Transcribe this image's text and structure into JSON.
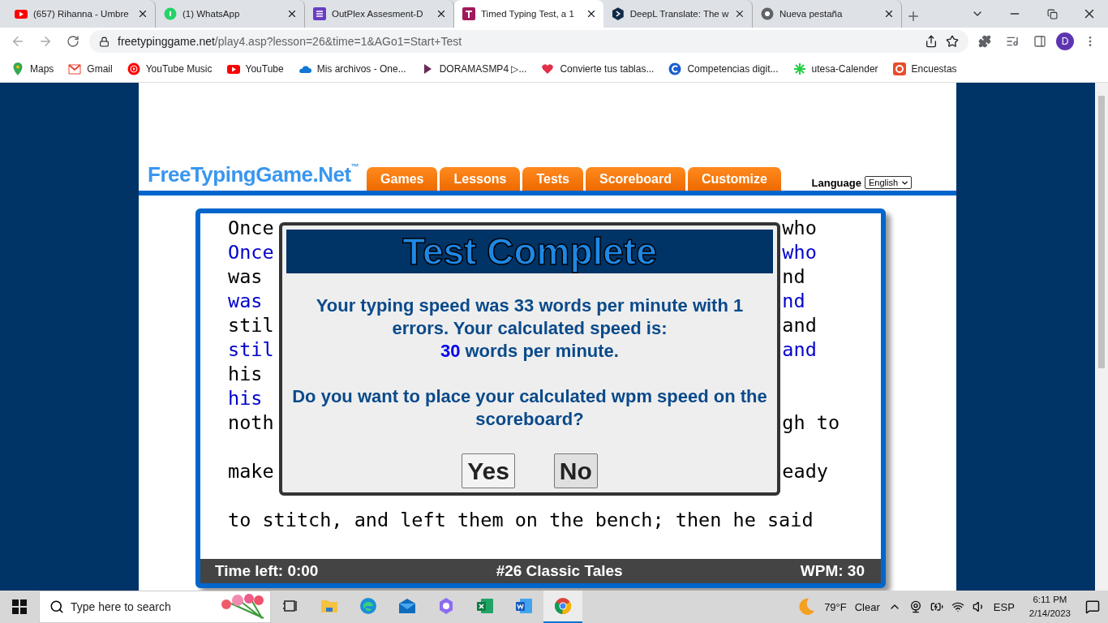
{
  "browser": {
    "tabs": [
      {
        "title": "(657) Rihanna - Umbre",
        "kind": "youtube",
        "selected": false
      },
      {
        "title": "(1) WhatsApp",
        "kind": "whatsapp",
        "selected": false
      },
      {
        "title": "OutPlex Assesment-D",
        "kind": "forms",
        "selected": false
      },
      {
        "title": "Timed Typing Test, a 1",
        "kind": "typing",
        "selected": true
      },
      {
        "title": "DeepL Translate: The w",
        "kind": "deepl",
        "selected": false
      },
      {
        "title": "Nueva pestaña",
        "kind": "chrome",
        "selected": false
      }
    ],
    "url_host": "freetypinggame.net",
    "url_path": "/play4.asp?lesson=26&time=1&AGo1=Start+Test",
    "profile": "D",
    "bookmarks": [
      {
        "label": "Maps",
        "kind": "maps"
      },
      {
        "label": "Gmail",
        "kind": "gmail"
      },
      {
        "label": "YouTube Music",
        "kind": "ytmusic"
      },
      {
        "label": "YouTube",
        "kind": "youtube"
      },
      {
        "label": "Mis archivos - One...",
        "kind": "onedrive"
      },
      {
        "label": "DORAMASMP4 ▷...",
        "kind": "play"
      },
      {
        "label": "Convierte tus tablas...",
        "kind": "heart"
      },
      {
        "label": "Competencias digit...",
        "kind": "c"
      },
      {
        "label": "utesa-Calender",
        "kind": "spark"
      },
      {
        "label": "Encuestas",
        "kind": "survey"
      }
    ]
  },
  "site": {
    "logo": "FreeTypingGame.Net$^{™}$",
    "nav": [
      "Games",
      "Lessons",
      "Tests",
      "Scoreboard",
      "Customize"
    ],
    "language_label": "Language",
    "language": "English",
    "passage": [
      {
        "text_left": "Once",
        "text_right": "who",
        "typed_left": "Once",
        "typed_right": "who"
      },
      {
        "text_left": "was",
        "text_right": "nd",
        "typed_left": "was",
        "typed_right": "nd"
      },
      {
        "text_left": "stil",
        "text_right": "and",
        "typed_left": "stil",
        "typed_right": "and"
      },
      {
        "text_left": "his",
        "typed_left": "his"
      },
      {
        "text_left": "noth",
        "text_right": "gh to"
      },
      {
        "text_left": "make",
        "text_right": "eady"
      },
      {
        "text_left": "to stitch, and left them on the bench; then he said"
      }
    ],
    "status": {
      "time_left": "Time left: 0:00",
      "lesson": "#26 Classic Tales",
      "wpm": "WPM: 30"
    },
    "dialog": {
      "title": "Test Complete",
      "message": "Your typing speed was 33 words per minute with 1 errors. Your calculated speed is:",
      "speed": "30",
      "speed_unit": "words per minute.",
      "question": "Do you want to place your calculated wpm speed on the scoreboard?",
      "buttons": [
        "Yes",
        "No"
      ]
    }
  },
  "taskbar": {
    "search_placeholder": "Type here to search",
    "apps": [
      {
        "kind": "taskview",
        "selected": false
      },
      {
        "kind": "explorer",
        "selected": false
      },
      {
        "kind": "edge",
        "selected": false
      },
      {
        "kind": "mail",
        "selected": false
      },
      {
        "kind": "m365",
        "selected": false
      },
      {
        "kind": "excel",
        "selected": false
      },
      {
        "kind": "word",
        "selected": false
      },
      {
        "kind": "chrome",
        "selected": true
      }
    ],
    "temperature": "79°F",
    "weather": "Clear",
    "language": "ESP",
    "time": "6:11 PM",
    "date": "2/14/2023"
  }
}
